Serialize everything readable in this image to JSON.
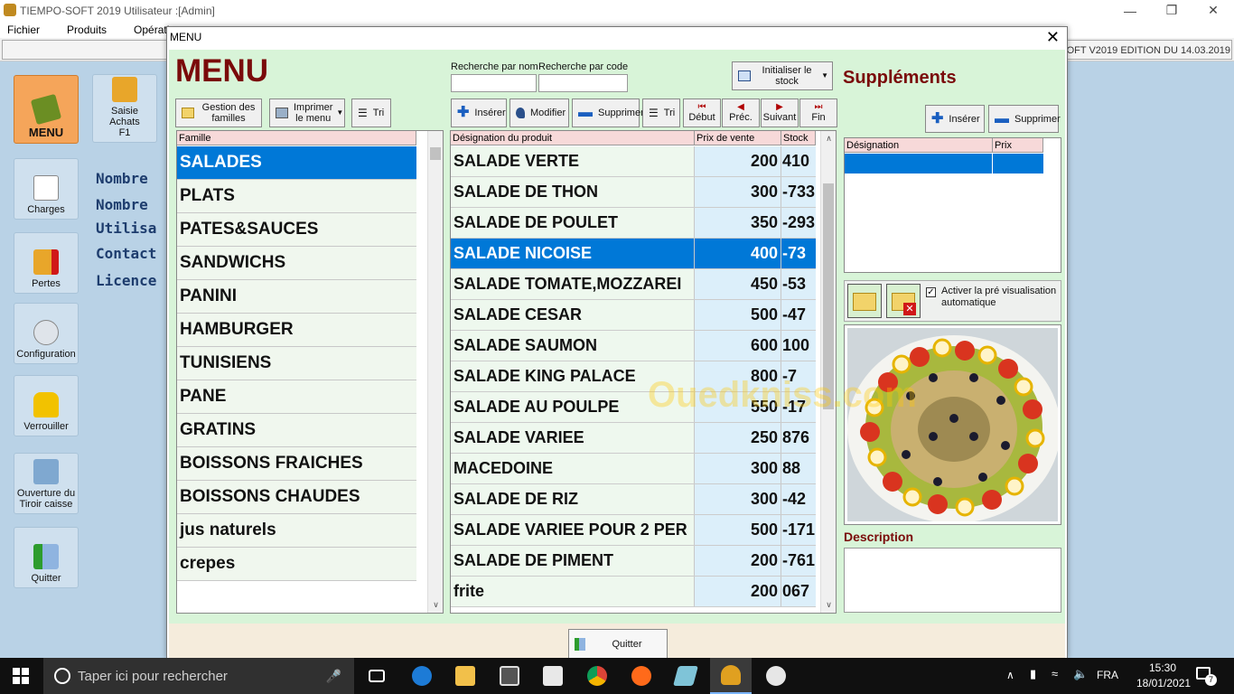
{
  "window": {
    "title": "TIEMPO-SOFT 2019 Utilisateur :[Admin]",
    "version_text": "SOFT V2019 EDITION DU 14.03.2019"
  },
  "menubar": [
    "Fichier",
    "Produits",
    "Opération"
  ],
  "sidebar": {
    "menu": "MENU",
    "saisie": [
      "Saisie",
      "Achats",
      "F1"
    ],
    "charges": "Charges",
    "pertes": "Pertes",
    "configuration": "Configuration",
    "verrouiller": "Verrouiller",
    "ouverture": [
      "Ouverture du",
      "Tiroir caisse"
    ],
    "quitter": "Quitter"
  },
  "info_labels": [
    "Nombre",
    "Nombre",
    "Utilisa",
    "Contact",
    "Licence"
  ],
  "dialog": {
    "title": "MENU",
    "heading": "MENU",
    "gestion_familles": [
      "Gestion des",
      "familles"
    ],
    "imprimer_menu": [
      "Imprimer",
      "le menu"
    ],
    "tri": "Tri",
    "search_nom_label": "Recherche par nom",
    "search_code_label": "Recherche par code",
    "search_nom_value": "",
    "search_code_value": "",
    "init_stock": [
      "Initialiser le",
      "stock"
    ],
    "inserer": "Insérer",
    "modifier": "Modifier",
    "supprimer": "Supprimer",
    "nav": {
      "debut": "Début",
      "prec": "Préc.",
      "suivant": "Suivant",
      "fin": "Fin"
    },
    "family_header": "Famille",
    "families": [
      "SALADES",
      "PLATS",
      "PATES&SAUCES",
      "SANDWICHS",
      "PANINI",
      "HAMBURGER",
      "TUNISIENS",
      "PANE",
      "GRATINS",
      "BOISSONS FRAICHES",
      "BOISSONS CHAUDES",
      "jus naturels",
      "crepes"
    ],
    "selected_family": "SALADES",
    "product_headers": {
      "designation": "Désignation du produit",
      "prix": "Prix de vente",
      "stock": "Stock"
    },
    "products": [
      {
        "name": "SALADE VERTE",
        "price": "200",
        "stock": "410"
      },
      {
        "name": "SALADE DE THON",
        "price": "300",
        "stock": "-733"
      },
      {
        "name": "SALADE DE POULET",
        "price": "350",
        "stock": "-293"
      },
      {
        "name": "SALADE NICOISE",
        "price": "400",
        "stock": "-73"
      },
      {
        "name": "SALADE TOMATE,MOZZAREI",
        "price": "450",
        "stock": "-53"
      },
      {
        "name": "SALADE CESAR",
        "price": "500",
        "stock": "-47"
      },
      {
        "name": "SALADE SAUMON",
        "price": "600",
        "stock": "100"
      },
      {
        "name": "SALADE KING PALACE",
        "price": "800",
        "stock": "-7"
      },
      {
        "name": "SALADE AU POULPE",
        "price": "550",
        "stock": "-17"
      },
      {
        "name": "SALADE VARIEE",
        "price": "250",
        "stock": "876"
      },
      {
        "name": "MACEDOINE",
        "price": "300",
        "stock": "88"
      },
      {
        "name": "SALADE DE RIZ",
        "price": "300",
        "stock": "-42"
      },
      {
        "name": "SALADE VARIEE POUR 2 PER",
        "price": "500",
        "stock": "-171"
      },
      {
        "name": "SALADE DE PIMENT",
        "price": "200",
        "stock": "-761"
      },
      {
        "name": "frite",
        "price": "200",
        "stock": "067"
      }
    ],
    "selected_product": "SALADE NICOISE",
    "supplements_title": "Suppléments",
    "supp_headers": {
      "designation": "Désignation",
      "prix": "Prix"
    },
    "preview_label": [
      "Activer la pré visualisation",
      "automatique"
    ],
    "preview_checked": true,
    "description_title": "Description",
    "description_value": "",
    "quitter": "Quitter"
  },
  "watermark": "Ouedkniss.com",
  "taskbar": {
    "search_placeholder": "Taper ici pour rechercher",
    "lang": "FRA",
    "time": "15:30",
    "date": "18/01/2021",
    "notif_count": "7"
  },
  "colors": {
    "title_red": "#7a0a0a",
    "selection_blue": "#0078d7",
    "panel_green": "#d8f4d8"
  }
}
